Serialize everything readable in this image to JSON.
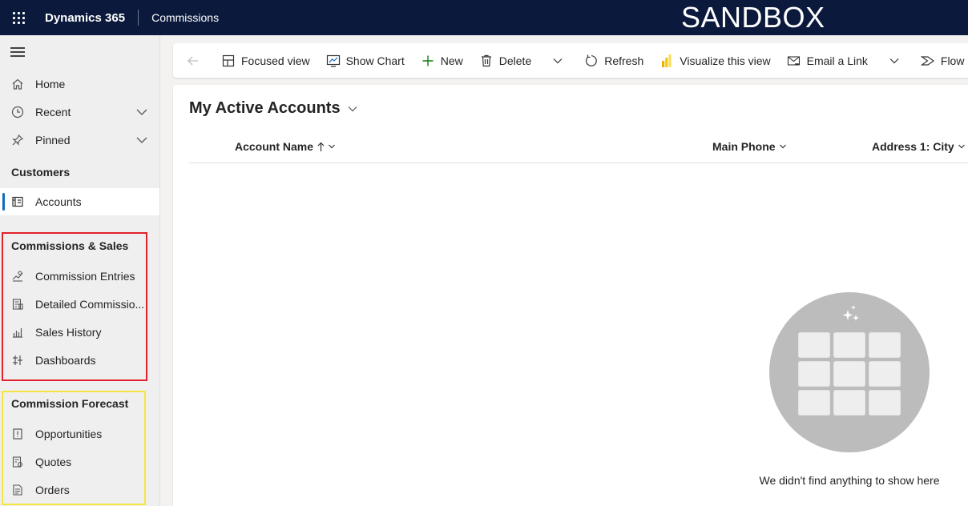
{
  "topbar": {
    "brand": "Dynamics 365",
    "app_name": "Commissions",
    "environment_banner": "SANDBOX"
  },
  "sidebar": {
    "items": [
      {
        "label": "Home",
        "icon": "home-icon"
      },
      {
        "label": "Recent",
        "icon": "clock-icon",
        "expandable": true
      },
      {
        "label": "Pinned",
        "icon": "pin-icon",
        "expandable": true
      }
    ],
    "sections": [
      {
        "title": "Customers",
        "items": [
          {
            "label": "Accounts",
            "icon": "accounts-icon",
            "selected": true
          }
        ]
      },
      {
        "title": "Commissions & Sales",
        "highlight": "#e0202b",
        "items": [
          {
            "label": "Commission Entries",
            "icon": "commission-entries-icon"
          },
          {
            "label": "Detailed Commissio...",
            "icon": "detailed-commission-icon"
          },
          {
            "label": "Sales History",
            "icon": "sales-history-icon"
          },
          {
            "label": "Dashboards",
            "icon": "dashboards-icon"
          }
        ]
      },
      {
        "title": "Commission Forecast",
        "highlight": "#f5e642",
        "items": [
          {
            "label": "Opportunities",
            "icon": "opportunities-icon"
          },
          {
            "label": "Quotes",
            "icon": "quotes-icon"
          },
          {
            "label": "Orders",
            "icon": "orders-icon"
          }
        ]
      }
    ]
  },
  "toolbar": {
    "focused_view": "Focused view",
    "show_chart": "Show Chart",
    "new": "New",
    "delete": "Delete",
    "refresh": "Refresh",
    "visualize": "Visualize this view",
    "email_link": "Email a Link",
    "flow": "Flow"
  },
  "view": {
    "title": "My Active Accounts",
    "columns": [
      {
        "label": "Account Name",
        "sort": "ascending"
      },
      {
        "label": "Main Phone"
      },
      {
        "label": "Address 1: City"
      }
    ],
    "empty_message": "We didn't find anything to show here"
  },
  "colors": {
    "topbar_bg": "#0b1a3c",
    "accent": "#0f6cbd",
    "new_plus": "#107c10",
    "powerbi": "#f2c811"
  }
}
